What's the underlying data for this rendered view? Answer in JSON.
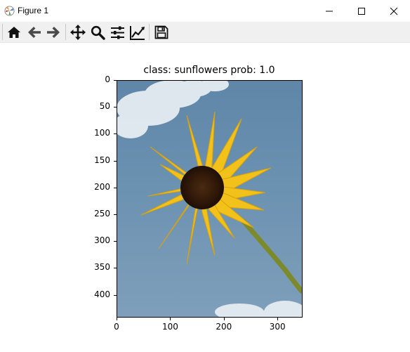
{
  "window": {
    "title": "Figure 1"
  },
  "plot": {
    "title": "class: sunflowers   prob: 1.0",
    "yticks": [
      "0",
      "50",
      "100",
      "150",
      "200",
      "250",
      "300",
      "350",
      "400"
    ],
    "xticks": [
      "0",
      "100",
      "200",
      "300"
    ]
  }
}
